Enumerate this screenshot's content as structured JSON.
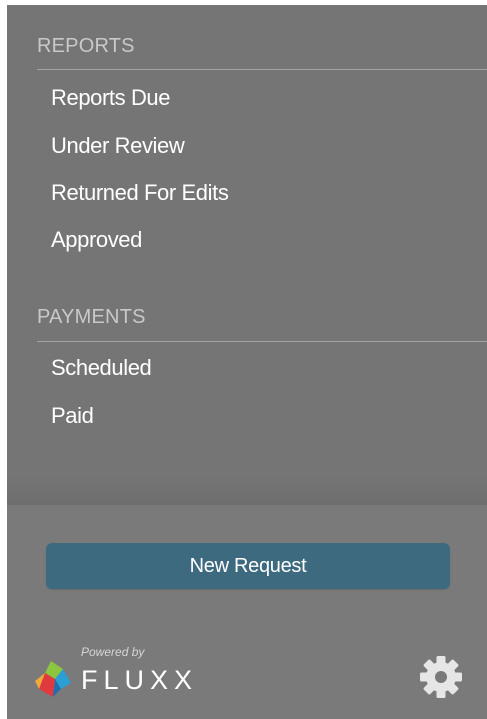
{
  "reports": {
    "header": "REPORTS",
    "items": [
      {
        "label": "Reports Due"
      },
      {
        "label": "Under Review"
      },
      {
        "label": "Returned For Edits"
      },
      {
        "label": "Approved"
      }
    ]
  },
  "payments": {
    "header": "PAYMENTS",
    "items": [
      {
        "label": "Scheduled"
      },
      {
        "label": "Paid"
      }
    ]
  },
  "footer": {
    "new_request_label": "New Request",
    "powered_by": "Powered by",
    "brand_name": "FLUXX",
    "settings_icon": "gear-icon"
  },
  "colors": {
    "sidebar_bg": "#757575",
    "footer_bg": "#7a7a7a",
    "button_bg": "#3e6a7f",
    "header_text": "#c9c9c9",
    "item_text": "#ffffff"
  }
}
